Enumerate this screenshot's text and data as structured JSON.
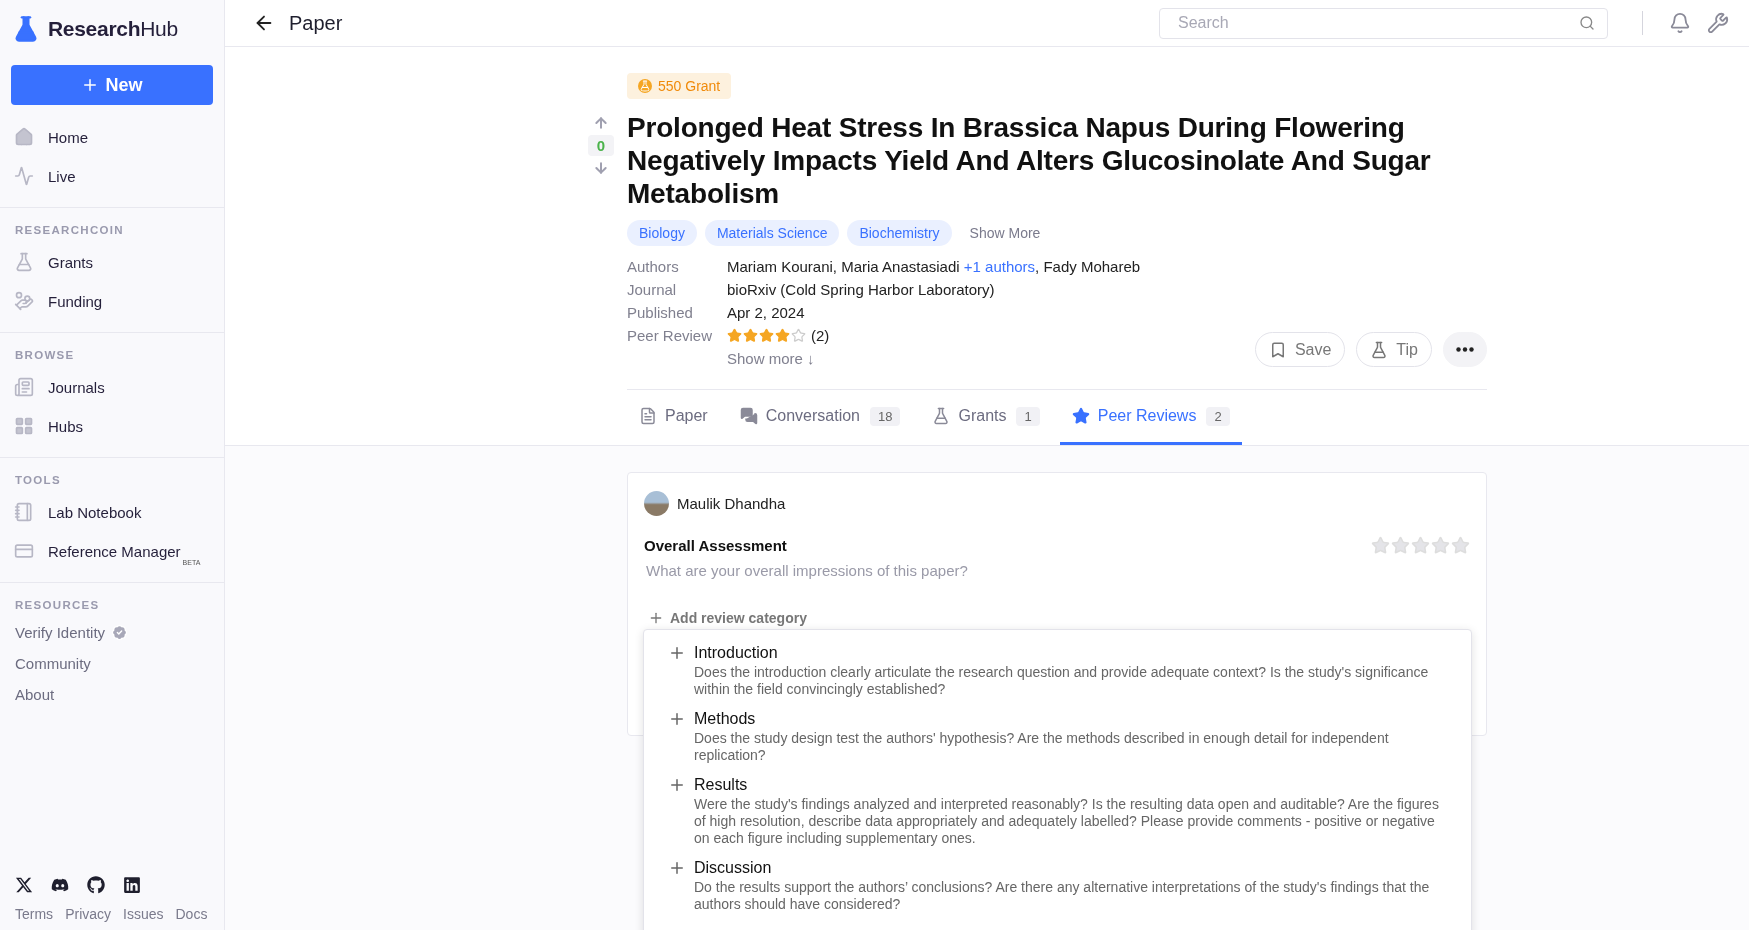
{
  "sidebar": {
    "logo": {
      "bold": "Research",
      "light": "Hub"
    },
    "new_button": "New",
    "primary": [
      {
        "label": "Home"
      },
      {
        "label": "Live"
      }
    ],
    "sections": [
      {
        "heading": "RESEARCHCOIN",
        "items": [
          {
            "label": "Grants"
          },
          {
            "label": "Funding"
          }
        ]
      },
      {
        "heading": "BROWSE",
        "items": [
          {
            "label": "Journals"
          },
          {
            "label": "Hubs"
          }
        ]
      },
      {
        "heading": "TOOLS",
        "items": [
          {
            "label": "Lab Notebook"
          },
          {
            "label": "Reference Manager",
            "badge": "BETA"
          }
        ]
      }
    ],
    "resources": {
      "heading": "RESOURCES",
      "links": [
        {
          "label": "Verify Identity",
          "verified": true
        },
        {
          "label": "Community",
          "verified": false
        },
        {
          "label": "About",
          "verified": false
        }
      ]
    },
    "footer_links": [
      "Terms",
      "Privacy",
      "Issues",
      "Docs"
    ]
  },
  "header": {
    "title": "Paper",
    "search": {
      "placeholder": "Search"
    }
  },
  "paper": {
    "grant_badge": "550 Grant",
    "votes": "0",
    "title": "Prolonged Heat Stress In Brassica Napus During Flowering Negatively Impacts Yield And Alters Glucosinolate And Sugar Metabolism",
    "tags": [
      "Biology",
      "Materials Science",
      "Biochemistry"
    ],
    "show_more_tags": "Show More",
    "meta": [
      {
        "label": "Authors",
        "kind": "authors",
        "before": "Mariam Kourani, Maria Anastasiadi",
        "link": "+1 authors",
        "after": ", Fady Mohareb"
      },
      {
        "label": "Journal",
        "kind": "text",
        "value": "bioRxiv (Cold Spring Harbor Laboratory)"
      },
      {
        "label": "Published",
        "kind": "text",
        "value": "Apr 2, 2024"
      },
      {
        "label": "Peer Review",
        "kind": "rating",
        "stars": 4,
        "count": "(2)"
      }
    ],
    "show_more": "Show more ↓",
    "actions": [
      {
        "label": "Save",
        "kind": "save"
      },
      {
        "label": "Tip",
        "kind": "tip"
      },
      {
        "kind": "more"
      }
    ]
  },
  "tabs": [
    {
      "label": "Paper",
      "selected": false
    },
    {
      "label": "Conversation",
      "count": "18",
      "selected": false
    },
    {
      "label": "Grants",
      "count": "1",
      "selected": false
    },
    {
      "label": "Peer Reviews",
      "count": "2",
      "selected": true
    }
  ],
  "review": {
    "author": "Maulik Dhandha",
    "heading": "Overall Assessment",
    "placeholder": "What are your overall impressions of this paper?",
    "stars": 0,
    "add_category": "Add review category",
    "categories": [
      {
        "title": "Introduction",
        "description": "Does the introduction clearly articulate the research question and provide adequate context? Is the study's significance within the field convincingly established?"
      },
      {
        "title": "Methods",
        "description": "Does the study design test the authors' hypothesis? Are the methods described in enough detail for independent replication?"
      },
      {
        "title": "Results",
        "description": "Were the study's findings analyzed and interpreted reasonably? Is the resulting data open and auditable? Are the figures of high resolution, describe data appropriately and adequately labelled? Please provide comments - positive or negative on each figure including supplementary ones."
      },
      {
        "title": "Discussion",
        "description": "Do the results support the authors’ conclusions? Are there any alternative interpretations of the study's findings that the authors should have considered?"
      }
    ]
  }
}
